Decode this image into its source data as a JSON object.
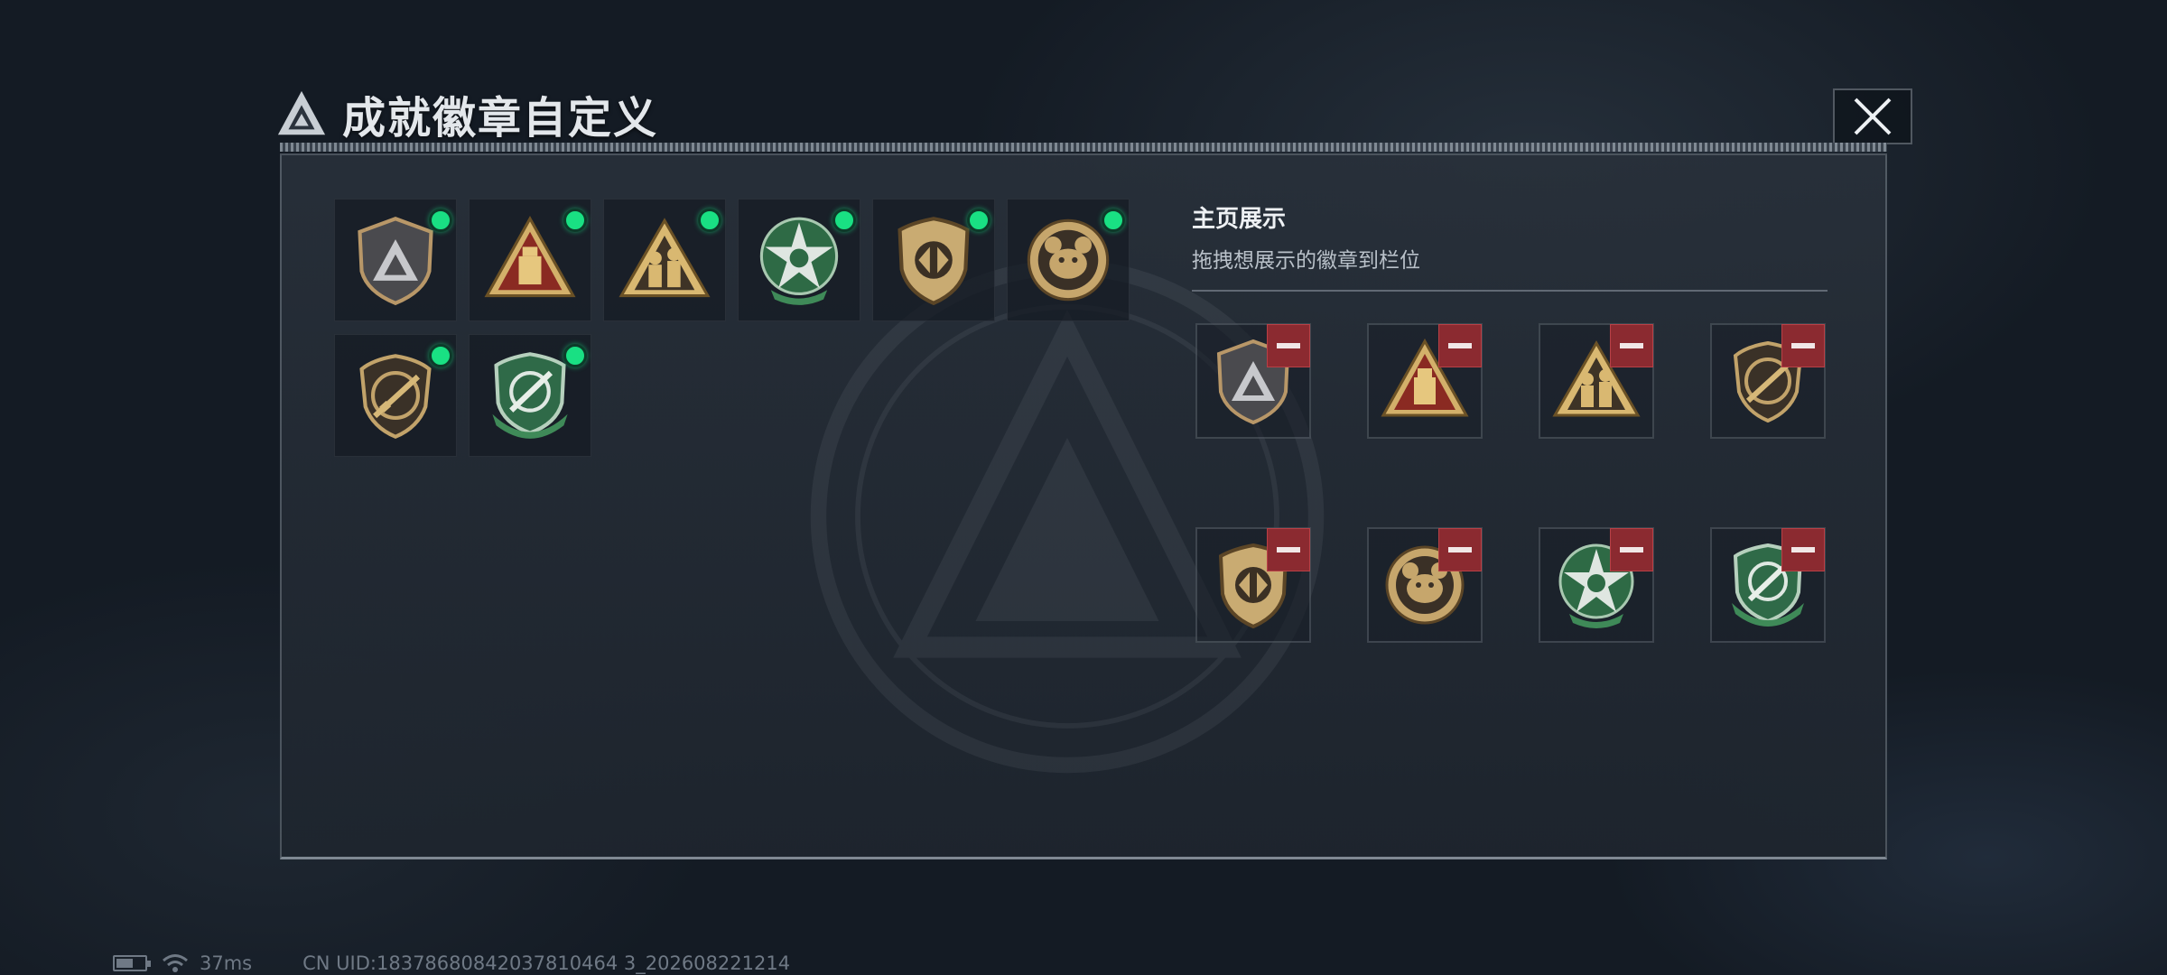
{
  "dialog": {
    "title": "成就徽章自定义",
    "logo_icon": "triangle-logo-icon",
    "close_icon": "close-icon"
  },
  "owned_badges": [
    {
      "icon": "gray-shield-triangle-badge-icon",
      "selected": true
    },
    {
      "icon": "red-triangle-usb-badge-icon",
      "selected": true
    },
    {
      "icon": "gold-triangle-soldiers-badge-icon",
      "selected": true
    },
    {
      "icon": "green-star-skull-badge-icon",
      "selected": true
    },
    {
      "icon": "bronze-shield-arrows-badge-icon",
      "selected": true
    },
    {
      "icon": "gold-round-bear-badge-icon",
      "selected": true
    },
    {
      "icon": "bronze-shield-rifle-badge-icon",
      "selected": true
    },
    {
      "icon": "green-shield-knife-badge-icon",
      "selected": true
    }
  ],
  "showcase": {
    "title": "主页展示",
    "subtitle": "拖拽想展示的徽章到栏位",
    "slots": [
      {
        "icon": "gray-shield-triangle-badge-icon"
      },
      {
        "icon": "red-triangle-usb-badge-icon"
      },
      {
        "icon": "gold-triangle-soldiers-badge-icon"
      },
      {
        "icon": "bronze-shield-rifle-badge-icon"
      },
      {
        "icon": "bronze-shield-arrows-badge-icon"
      },
      {
        "icon": "gold-round-bear-badge-icon"
      },
      {
        "icon": "green-star-skull-badge-icon"
      },
      {
        "icon": "green-shield-knife-badge-icon"
      }
    ]
  },
  "status": {
    "ping": "37ms",
    "uid": "CN UID:18378680842037810464 3_202608221214"
  },
  "colors": {
    "selected_dot": "#19e083",
    "remove_button": "#8b2a30"
  }
}
